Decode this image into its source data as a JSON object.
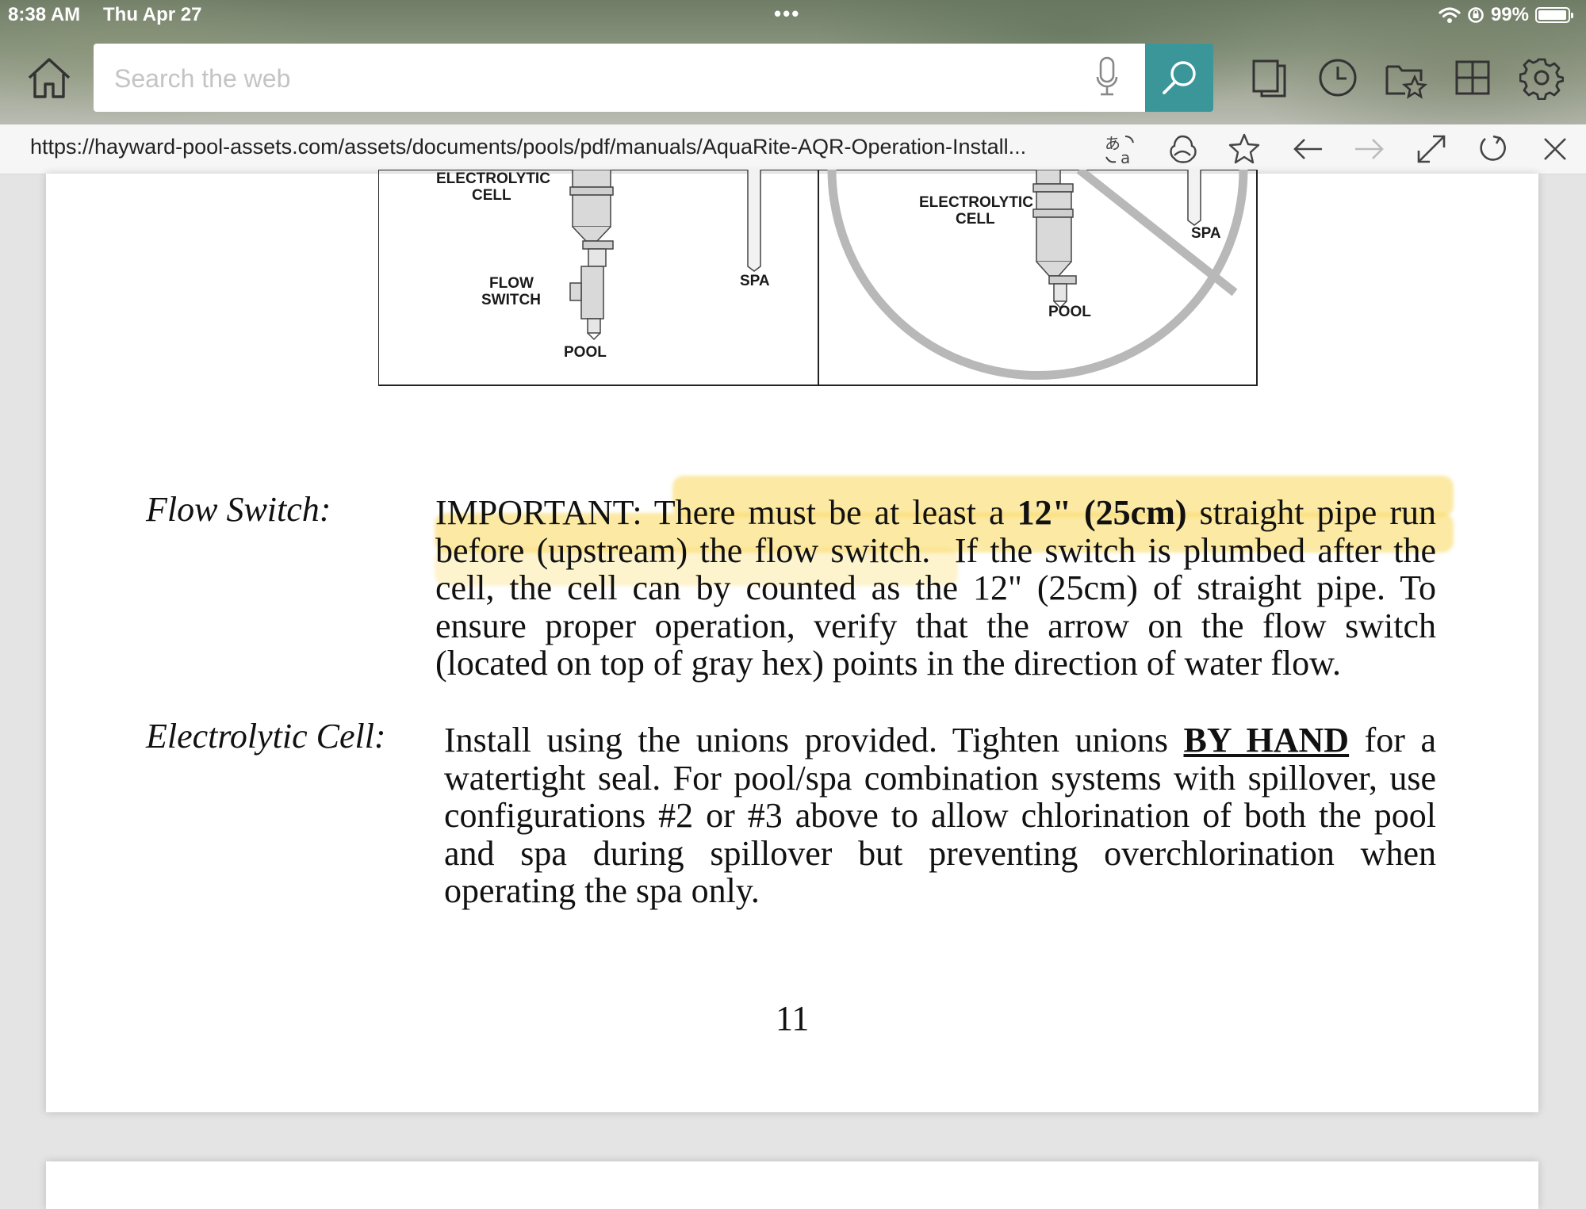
{
  "status_bar": {
    "time": "8:38 AM",
    "date": "Thu Apr 27",
    "battery": "99%"
  },
  "toolbar": {
    "search_placeholder": "Search the web",
    "icons": [
      "home-icon",
      "microphone-icon",
      "search-icon",
      "tabs-icon",
      "history-icon",
      "favorites-icon",
      "apps-grid-icon",
      "settings-icon"
    ]
  },
  "url_bar": {
    "url": "https://hayward-pool-assets.com/assets/documents/pools/pdf/manuals/AquaRite-AQR-Operation-Install...",
    "icons": [
      "translate-icon",
      "share-icon",
      "star-icon",
      "back-icon",
      "forward-icon",
      "fullscreen-icon",
      "refresh-icon",
      "close-icon"
    ]
  },
  "diagram": {
    "left": {
      "electrolytic_cell_line1": "ELECTROLYTIC",
      "electrolytic_cell_line2": "CELL",
      "flow_switch_line1": "FLOW",
      "flow_switch_line2": "SWITCH",
      "spa": "SPA",
      "pool": "POOL"
    },
    "right": {
      "electrolytic_cell_line1": "ELECTROLYTIC",
      "electrolytic_cell_line2": "CELL",
      "spa": "SPA",
      "pool": "POOL"
    }
  },
  "document": {
    "flow_switch": {
      "term": "Flow Switch:",
      "important_label": "IMPORTANT:",
      "text_a": "There must be at least a",
      "text_bold": "12\" (25cm)",
      "text_b": "straight pipe run before (upstream) the flow switch.",
      "text_c": "If the switch is plumbed after the cell, the cell can by counted as the 12\" (25cm) of straight pipe.  To ensure proper operation, verify that the arrow on the flow switch (located on top of gray hex) points in the direction of water flow."
    },
    "electrolytic_cell": {
      "term": "Electrolytic Cell:",
      "text_a": "Install using the unions provided.  Tighten unions",
      "text_emphasis": "BY HAND",
      "text_b": "for a watertight seal.  For pool/spa combination systems with spillover, use configurations #2 or #3 above to allow chlorination of both the pool and spa during spillover but preventing overchlorination when operating the spa only."
    },
    "page_number": "11"
  },
  "colors": {
    "search_button": "#3a9699",
    "highlight": "#fad75a"
  }
}
